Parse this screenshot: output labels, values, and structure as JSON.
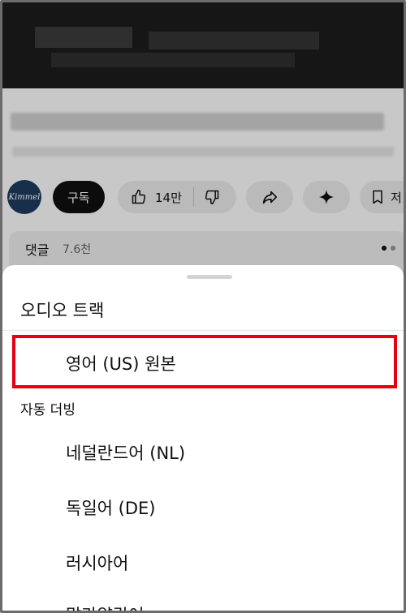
{
  "background": {
    "subscribe_label": "구독",
    "like_count": "14만",
    "save_label": "저",
    "channel_avatar_text": "Kimmel",
    "comments_label": "댓글",
    "comments_count": "7.6천"
  },
  "sheet": {
    "title": "오디오 트랙",
    "selected_option": "영어 (US) 원본",
    "section_label": "자동 더빙",
    "options": [
      {
        "label": "네덜란드어 (NL)"
      },
      {
        "label": "독일어 (DE)"
      },
      {
        "label": "러시아어"
      },
      {
        "label": "말라얄람어"
      }
    ]
  },
  "colors": {
    "highlight": "#e60012",
    "subscribe_bg": "#0f0f0f",
    "pill_bg": "#e3e3e3"
  },
  "icons": [
    "thumb-up-icon",
    "thumb-down-icon",
    "share-icon",
    "sparkle-icon",
    "bookmark-icon"
  ]
}
